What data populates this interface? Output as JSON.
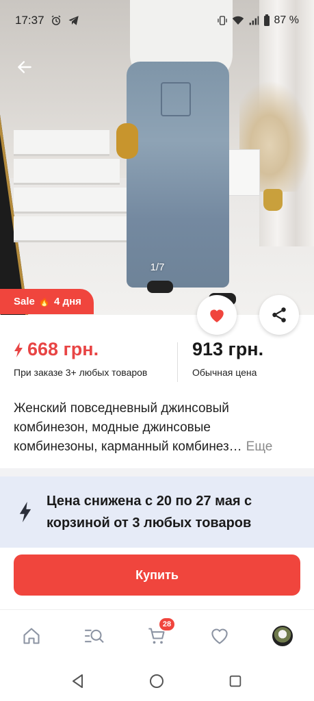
{
  "status_bar": {
    "time": "17:37",
    "battery": "87 %"
  },
  "gallery": {
    "counter": "1/7"
  },
  "sale_badge": {
    "label": "Sale",
    "emoji": "🔥",
    "days": "4 дня"
  },
  "prices": {
    "sale_price": "668 грн.",
    "sale_note": "При заказе 3+ любых товаров",
    "regular_price": "913 грн.",
    "regular_note": "Обычная цена"
  },
  "product": {
    "title_line1": "Женский повседневный джинсовый",
    "title_line2": "комбинезон, модные джинсовые",
    "title_line3": "комбинезоны, карманный комбинез…",
    "more_label": "Еще"
  },
  "promo": {
    "text": "Цена снижена с 20 по 27 мая с корзиной от 3 любых товаров"
  },
  "buy_button": {
    "label": "Купить"
  },
  "tabbar": {
    "cart_count": "28",
    "icons": [
      "home-icon",
      "catalog-search-icon",
      "cart-icon",
      "heart-icon",
      "avatar"
    ]
  },
  "colors": {
    "accent": "#f0453d",
    "price_sale": "#e84545",
    "promo_bg": "#e6ebf7"
  }
}
